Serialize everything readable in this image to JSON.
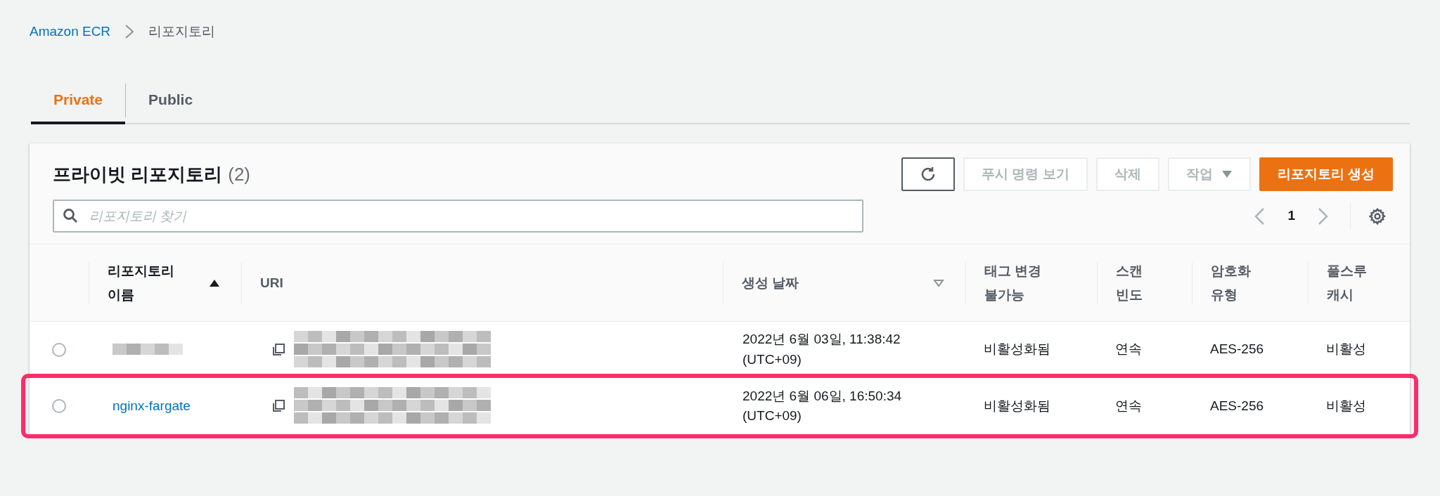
{
  "breadcrumb": [
    {
      "label": "Amazon ECR",
      "link": true
    },
    {
      "label": "리포지토리",
      "link": false
    }
  ],
  "tabs": [
    {
      "label": "Private",
      "selected": true
    },
    {
      "label": "Public",
      "selected": false
    }
  ],
  "panel": {
    "title": "프라이빗 리포지토리",
    "count": "(2)",
    "buttons": [
      {
        "kind": "refresh",
        "disabled": false
      },
      {
        "kind": "text",
        "label": "푸시 명령 보기",
        "disabled": true
      },
      {
        "kind": "text",
        "label": "삭제",
        "disabled": true
      },
      {
        "kind": "dropdown",
        "label": "작업",
        "disabled": true
      },
      {
        "kind": "primary",
        "label": "리포지토리 생성",
        "disabled": false
      }
    ],
    "search": {
      "placeholder": "리포지토리 찾기"
    },
    "page": "1"
  },
  "table": {
    "columns": [
      {
        "label": "리포지토리\n이름",
        "sortable": true,
        "sort_active": true,
        "descending": false
      },
      {
        "label": "URI",
        "sortable": false
      },
      {
        "label": "생성 날짜",
        "sortable": true,
        "sort_active": false,
        "descending": true
      },
      {
        "label": "태그 변경\n불가능",
        "sortable": false
      },
      {
        "label": "스캔\n빈도",
        "sortable": false
      },
      {
        "label": "암호화\n유형",
        "sortable": false
      },
      {
        "label": "풀스루\n캐시",
        "sortable": false
      }
    ],
    "rows": [
      {
        "selected": false,
        "highlighted": false,
        "name_hidden": true,
        "created": "2022년 6월 03일, 11:38:42 (UTC+09)",
        "tag_immutability": "비활성화됨",
        "scan": "연속",
        "encryption": "AES-256",
        "pull_through": "비활성"
      },
      {
        "selected": false,
        "highlighted": true,
        "name_hidden": false,
        "name": "nginx-fargate",
        "created": "2022년 6월 06일, 16:50:34 (UTC+09)",
        "tag_immutability": "비활성화됨",
        "scan": "연속",
        "encryption": "AES-256",
        "pull_through": "비활성"
      }
    ]
  }
}
